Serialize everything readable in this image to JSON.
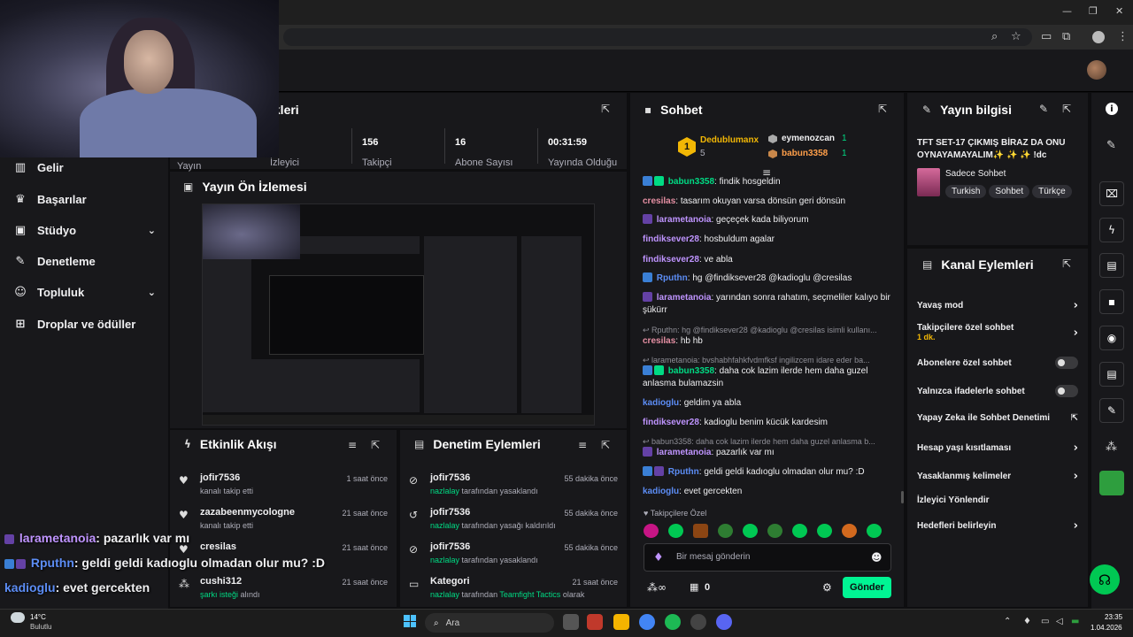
{
  "sidebar": {
    "items": [
      {
        "label": "Gelir",
        "icon": "chart-icon"
      },
      {
        "label": "Başarılar",
        "icon": "trophy-icon"
      },
      {
        "label": "Stüdyo",
        "icon": "studio-icon"
      },
      {
        "label": "Denetleme",
        "icon": "wrench-icon"
      },
      {
        "label": "Topluluk",
        "icon": "community-icon"
      },
      {
        "label": "Droplar ve ödüller",
        "icon": "gift-icon"
      }
    ]
  },
  "stats": {
    "title_partial": "ikleri",
    "label_partial_1": "Yayın",
    "label_partial_2": "İzleyici",
    "followers_value": "156",
    "followers_label": "Takipçi",
    "subs_value": "16",
    "subs_label": "Abone Sayısı",
    "uptime_value": "00:31:59",
    "uptime_label": "Yayında Olduğu"
  },
  "preview": {
    "title": "Yayın Ön İzlemesi"
  },
  "activity": {
    "title": "Etkinlik Akışı",
    "items": [
      {
        "name": "jofir7536",
        "desc": "kanalı takip etti",
        "time": "1 saat önce"
      },
      {
        "name": "zazabeenmycologne",
        "desc": "kanalı takip etti",
        "time": "21 saat önce"
      },
      {
        "name": "cresilas",
        "desc": "",
        "time": "21 saat önce"
      },
      {
        "name": "cushi312",
        "desc": "şarkı isteği",
        "desc2": "alındı",
        "time": "21 saat önce"
      }
    ]
  },
  "moderation": {
    "title": "Denetim Eylemleri",
    "items": [
      {
        "name": "jofir7536",
        "by": "nazlalay",
        "action": "tarafından yasaklandı",
        "time": "55 dakika önce"
      },
      {
        "name": "jofir7536",
        "by": "nazlalay",
        "action": "tarafından yasağı kaldırıldı",
        "time": "55 dakika önce"
      },
      {
        "name": "jofir7536",
        "by": "nazlalay",
        "action": "tarafından yasaklandı",
        "time": "55 dakika önce"
      },
      {
        "name": "Kategori",
        "by": "nazlalay",
        "action": "tarafından",
        "game": "Teamfight Tactics",
        "suffix": "olarak",
        "time": "21 saat önce"
      }
    ]
  },
  "chat": {
    "title": "Sohbet",
    "leaderboard": {
      "first": {
        "rank": "1",
        "name": "Dedublumanx",
        "count": "5"
      },
      "second": {
        "name": "eymenozcan",
        "count": "1"
      },
      "third": {
        "name": "babun3358",
        "count": "1"
      }
    },
    "messages": [
      {
        "user": "babun3358",
        "text": "findik hosgeldin",
        "color": "green"
      },
      {
        "user": "cresilas",
        "text": "tasarım okuyan varsa dönsün geri dönsün",
        "color": "pink"
      },
      {
        "user": "larametanoia",
        "text": "geçeçek kada biliyorum",
        "color": "purple"
      },
      {
        "user": "findiksever28",
        "text": "hosbuldum agalar",
        "color": "purple"
      },
      {
        "user": "findiksever28",
        "text": "ve abla",
        "color": "purple"
      },
      {
        "user": "Rputhn",
        "text": "hg @findiksever28 @kadioglu @cresilas",
        "color": "blue"
      },
      {
        "user": "larametanoia",
        "text": "yarından sonra rahatım, seçmeliler kalıyo bir şükürr",
        "color": "purple"
      },
      {
        "reply": "Rputhn: hg @findiksever28 @kadioglu @cresilas isimli kullanı..."
      },
      {
        "user": "cresilas",
        "text": "hb hb",
        "color": "pink"
      },
      {
        "reply": "larametanoia: bvshabhfahkfvdmfksf ingilizcem idare eder ba..."
      },
      {
        "user": "babun3358",
        "text": "daha cok lazim ilerde hem daha guzel anlasma bulamazsin",
        "color": "green"
      },
      {
        "user": "kadioglu",
        "text": "geldim ya abla",
        "color": "blue"
      },
      {
        "user": "findiksever28",
        "text": "kadioglu benim kücük kardesim",
        "color": "purple"
      },
      {
        "reply": "babun3358: daha cok lazim ilerde hem daha guzel anlasma b..."
      },
      {
        "user": "larametanoia",
        "text": "pazarlık var mı",
        "color": "purple"
      },
      {
        "user": "Rputhn",
        "text": "geldi geldi kadıoglu olmadan olur mu? :D",
        "color": "blue"
      },
      {
        "user": "kadioglu",
        "text": "evet gercekten",
        "color": "blue"
      }
    ],
    "followers_only": "Takipçilere Özel",
    "placeholder": "Bir mesaj gönderin",
    "points": "0",
    "send_label": "Gönder"
  },
  "stream_info": {
    "title": "Yayın bilgisi",
    "stream_title": "TFT SET-17 ÇIKMIŞ BİRAZ DA ONU OYNAYAMAYALIM✨ ✨ ✨ !dc",
    "category": "Sadece Sohbet",
    "tags": [
      "Turkish",
      "Sohbet",
      "Türkçe"
    ]
  },
  "channel_actions": {
    "title": "Kanal Eylemleri",
    "items": [
      {
        "label": "Yavaş mod",
        "control": "arrow"
      },
      {
        "label": "Takipçilere özel sohbet",
        "sub": "1 dk.",
        "control": "arrow"
      },
      {
        "label": "Abonelere özel sohbet",
        "control": "toggle"
      },
      {
        "label": "Yalnızca ifadelerle sohbet",
        "control": "toggle"
      },
      {
        "label": "Yapay Zeka ile Sohbet Denetimi",
        "control": "external"
      },
      {
        "label": "Hesap yaşı kısıtlaması",
        "control": "arrow"
      },
      {
        "label": "Yasaklanmış kelimeler",
        "control": "arrow"
      },
      {
        "label": "İzleyici Yönlendir",
        "control": "none"
      },
      {
        "label": "Hedefleri belirleyin",
        "control": "arrow"
      }
    ]
  },
  "overlay_chat": [
    {
      "user": "larametanoia",
      "text": ": pazarlık var mı",
      "color": "#bf94ff"
    },
    {
      "user": "Rputhn",
      "text": ": geldi geldi kadıoglu olmadan olur mu? :D",
      "color": "#5c8df5"
    },
    {
      "user": "kadioglu",
      "text": ": evet gercekten",
      "color": "#5c8df5"
    }
  ],
  "taskbar": {
    "weather_temp": "14°C",
    "weather_desc": "Bulutlu",
    "search": "Ara",
    "time": "23:35",
    "date": "1.04.2026"
  },
  "colors": {
    "accent": "#00f593",
    "panel": "#18181b",
    "bg": "#0e0e10",
    "purple": "#bf94ff"
  }
}
